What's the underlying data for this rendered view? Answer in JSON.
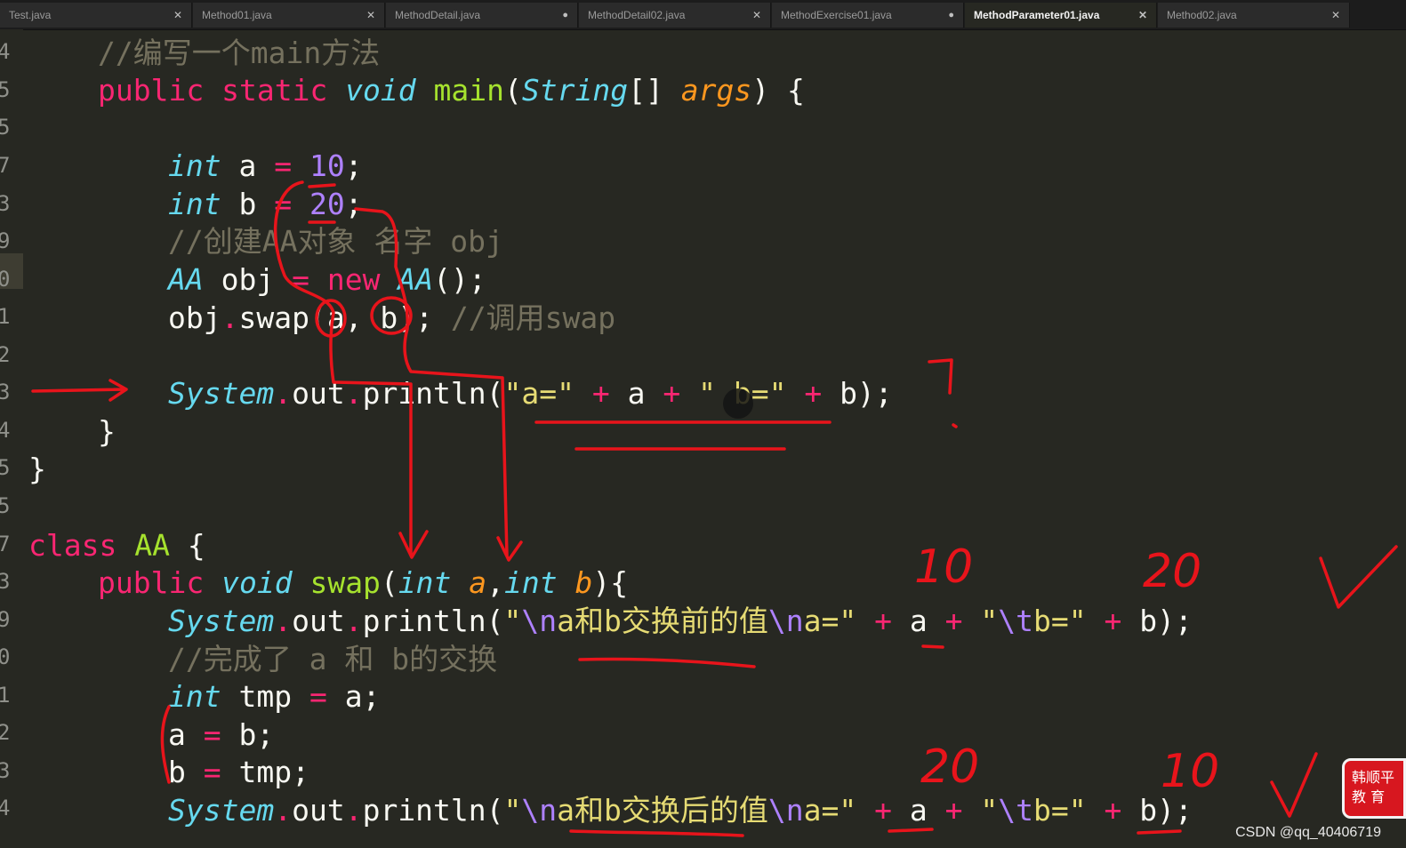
{
  "tabs": [
    {
      "label": "Test.java",
      "icon": "close-icon"
    },
    {
      "label": "Method01.java",
      "icon": "close-icon"
    },
    {
      "label": "MethodDetail.java",
      "icon": "unsaved-dot-icon"
    },
    {
      "label": "MethodDetail02.java",
      "icon": "close-icon"
    },
    {
      "label": "MethodExercise01.java",
      "icon": "unsaved-dot-icon"
    },
    {
      "label": "MethodParameter01.java",
      "icon": "close-icon",
      "active": true
    },
    {
      "label": "Method02.java",
      "icon": "close-icon"
    }
  ],
  "gutter": {
    "line_number_fragments": [
      "4",
      "5",
      "5",
      "7",
      "3",
      "9",
      "0",
      "1",
      "2",
      "3",
      "4",
      "5",
      "5",
      "7",
      "3",
      "9",
      "0",
      "1",
      "2",
      "3",
      "4"
    ]
  },
  "code": {
    "l4": {
      "comment": "//编写一个main方法"
    },
    "l5": {
      "kw1": "public",
      "kw2": "static",
      "ty": "void",
      "fn": "main",
      "p1": "(",
      "ty2": "String",
      "p2": "[] ",
      "pa": "args",
      "p3": ") {"
    },
    "l7": {
      "ty": "int",
      "v": " a ",
      "op": "=",
      "sp": " ",
      "num": "10",
      "end": ";"
    },
    "l8": {
      "ty": "int",
      "v": " b ",
      "op": "=",
      "sp": " ",
      "num": "20",
      "end": ";"
    },
    "l9": {
      "comment": "//创建AA对象 名字 obj"
    },
    "l10": {
      "ty": "AA",
      "v": " obj ",
      "op": "=",
      "sp": " ",
      "kw": "new",
      "sp2": " ",
      "ty2": "AA",
      "end": "();"
    },
    "l11": {
      "v": "obj",
      "dot": ".",
      "call": "swap(a, b);",
      "sp": " ",
      "comment": "//调用swap"
    },
    "l13": {
      "ty": "System",
      "dot": ".",
      "v": "out",
      "dot2": ".",
      "call": "println(",
      "s1": "\"a=\"",
      "o1": " + ",
      "a": "a",
      "o2": " + ",
      "s2": "\" b=\"",
      "o3": " + ",
      "end": "b);"
    },
    "l14": {
      "brace": "}"
    },
    "l15": {
      "brace": "}"
    },
    "l17": {
      "kw": "class",
      "sp": " ",
      "fn": "AA",
      "end": " {"
    },
    "l18": {
      "kw": "public",
      "sp": " ",
      "ty": "void",
      "sp2": " ",
      "fn": "swap",
      "p1": "(",
      "ty2": "int",
      "sp3": " ",
      "pa1": "a",
      "c": ",",
      "ty3": "int",
      "sp4": " ",
      "pa2": "b",
      "end": "){"
    },
    "l19": {
      "ty": "System",
      "dot": ".",
      "v": "out",
      "dot2": ".",
      "call": "println(",
      "q1": "\"",
      "e1": "\\n",
      "s1": "a和b交换前的值",
      "e2": "\\n",
      "s2": "a=\"",
      "o1": " + ",
      "a": "a",
      "o2": " + ",
      "q2": "\"",
      "e3": "\\t",
      "s3": "b=\"",
      "o3": " + ",
      "end": "b);"
    },
    "l20": {
      "comment": "//完成了 a 和 b的交换"
    },
    "l21": {
      "ty": "int",
      "v": " tmp ",
      "op": "=",
      "end": " a;"
    },
    "l22": {
      "v": "a ",
      "op": "=",
      "end": " b;"
    },
    "l23": {
      "v": "b ",
      "op": "=",
      "end": " tmp;"
    },
    "l24": {
      "ty": "System",
      "dot": ".",
      "v": "out",
      "dot2": ".",
      "call": "println(",
      "q1": "\"",
      "e1": "\\n",
      "s1": "a和b交换后的值",
      "e2": "\\n",
      "s2": "a=\"",
      "o1": " + ",
      "a": "a",
      "o2": " + ",
      "q2": "\"",
      "e3": "\\t",
      "s3": "b=\"",
      "o3": " + ",
      "end": "b);"
    }
  },
  "annotations": {
    "hand_written": [
      "10",
      "20",
      "20",
      "10"
    ],
    "marks": [
      "?",
      "✓",
      "✓"
    ]
  },
  "watermark": "CSDN @qq_40406719",
  "logo_text": "韩顺平\n教 育",
  "colors": {
    "background": "#272822",
    "keyword": "#f92672",
    "type": "#66d9ef",
    "function": "#a6e22e",
    "parameter": "#fd971f",
    "number": "#ae81ff",
    "string": "#e6db74",
    "comment": "#75715e",
    "ink": "#e8141b"
  }
}
